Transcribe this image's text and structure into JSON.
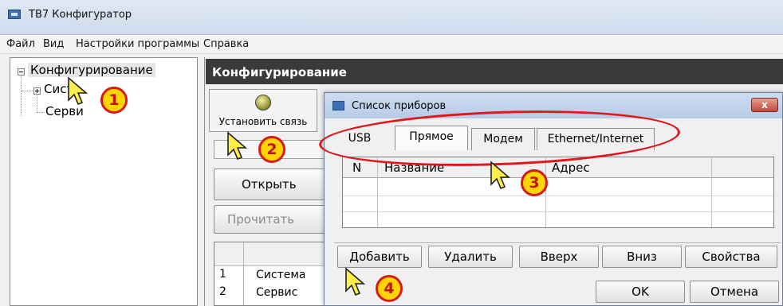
{
  "window": {
    "title": "ТВ7 Конфигуратор"
  },
  "menu": [
    "Файл",
    "Вид",
    "Настройки программы",
    "Справка"
  ],
  "tree": {
    "root": "Конфигурирование",
    "children": [
      "Сист",
      "Серви"
    ]
  },
  "panel": {
    "header": "Конфигурирование",
    "connect_button": "Установить связь",
    "open_button": "Открыть",
    "read_button": "Прочитать",
    "list": [
      {
        "n": "1",
        "name": "Система"
      },
      {
        "n": "2",
        "name": "Сервис"
      }
    ]
  },
  "dialog": {
    "title": "Список приборов",
    "close_label": "x",
    "tabs": [
      "USB",
      "Прямое",
      "Модем",
      "Ethernet/Internet"
    ],
    "active_tab": "Прямое",
    "table": {
      "columns": [
        "N",
        "Название",
        "Адрес",
        ""
      ],
      "rows": []
    },
    "buttons": [
      "Добавить",
      "Удалить",
      "Вверх",
      "Вниз",
      "Свойства"
    ],
    "ok": "OK",
    "cancel": "Отмена"
  },
  "markers": [
    "1",
    "2",
    "3",
    "4"
  ],
  "colors": {
    "annotation": "#e4151b",
    "marker_fill": "#ffd400",
    "panel_header": "#3a3a3a"
  },
  "icons": [
    "app-icon",
    "connect-icon",
    "close-icon",
    "cursor-icon"
  ]
}
